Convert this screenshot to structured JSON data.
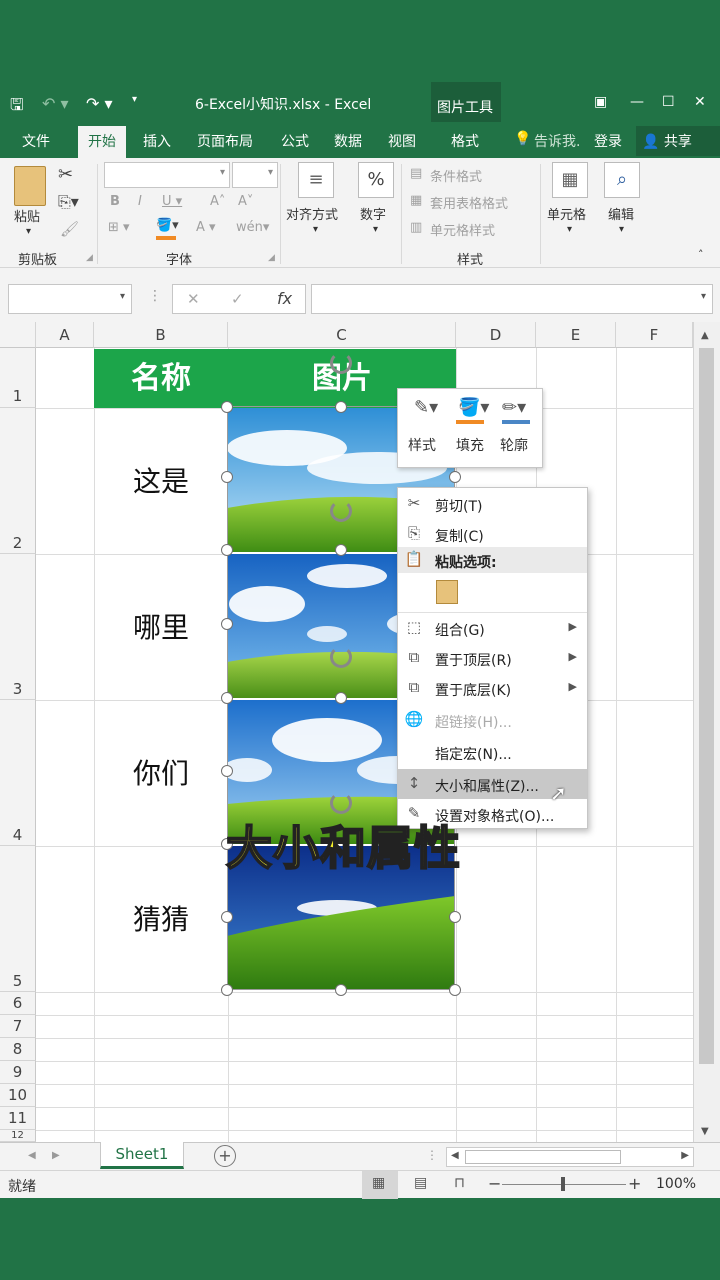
{
  "window": {
    "title": "6-Excel小知识.xlsx - Excel",
    "contextual_tab": "图片工具"
  },
  "ribbon_tabs": [
    "文件",
    "开始",
    "插入",
    "页面布局",
    "公式",
    "数据",
    "视图",
    "格式"
  ],
  "tell_me": "告诉我.",
  "login": "登录",
  "share": "共享",
  "ribbon": {
    "paste": "粘贴",
    "clipboard": "剪贴板",
    "font": "字体",
    "align": "对齐方式",
    "number": "数字",
    "cond_format": "条件格式",
    "table_format": "套用表格格式",
    "cell_style": "单元格样式",
    "styles": "样式",
    "cells": "单元格",
    "edit": "编辑"
  },
  "formula_bar": {
    "fx": "fx"
  },
  "columns": [
    "A",
    "B",
    "C",
    "D",
    "E",
    "F"
  ],
  "rows": [
    "1",
    "2",
    "3",
    "4",
    "5",
    "6",
    "7",
    "8",
    "9",
    "10",
    "11",
    "12"
  ],
  "header_row": {
    "b1": "名称",
    "c1": "图片"
  },
  "names": [
    "这是",
    "哪里",
    "你们",
    "猜猜"
  ],
  "mini_toolbar": [
    "样式",
    "填充",
    "轮廓"
  ],
  "context_menu": {
    "cut": "剪切(T)",
    "copy": "复制(C)",
    "paste_options": "粘贴选项:",
    "group": "组合(G)",
    "bring_front": "置于顶层(R)",
    "send_back": "置于底层(K)",
    "hyperlink": "超链接(H)...",
    "macro": "指定宏(N)...",
    "size_props": "大小和属性(Z)...",
    "format_obj": "设置对象格式(O)..."
  },
  "overlay_caption": "大小和属性",
  "sheet_tab": "Sheet1",
  "status": {
    "ready": "就绪",
    "zoom": "100%"
  },
  "colors": {
    "excel_green": "#217346",
    "header_green": "#1ca54a",
    "caption_yellow": "#f6f02a"
  }
}
